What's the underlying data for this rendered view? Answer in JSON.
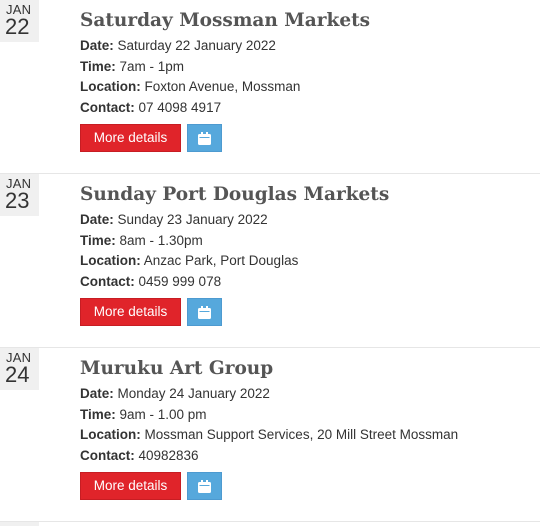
{
  "events": [
    {
      "month": "JAN",
      "day": "22",
      "title": "Saturday Mossman Markets",
      "date_label": "Date:",
      "date_value": " Saturday 22 January 2022",
      "time_label": "Time:",
      "time_value": " 7am - 1pm",
      "location_label": "Location:",
      "location_value": " Foxton Avenue, Mossman",
      "contact_label": "Contact:",
      "contact_value": " 07 4098 4917",
      "more_label": "More details",
      "calendar_icon": "calendar-icon"
    },
    {
      "month": "JAN",
      "day": "23",
      "title": "Sunday Port Douglas Markets",
      "date_label": "Date:",
      "date_value": " Sunday 23 January 2022",
      "time_label": "Time:",
      "time_value": " 8am - 1.30pm",
      "location_label": "Location:",
      "location_value": " Anzac Park, Port Douglas",
      "contact_label": "Contact:",
      "contact_value": " 0459 999 078",
      "more_label": "More details",
      "calendar_icon": "calendar-icon"
    },
    {
      "month": "JAN",
      "day": "24",
      "title": "Muruku Art Group",
      "date_label": "Date:",
      "date_value": " Monday 24 January 2022",
      "time_label": "Time:",
      "time_value": " 9am - 1.00 pm",
      "location_label": "Location:",
      "location_value": " Mossman Support Services, 20 Mill Street Mossman",
      "contact_label": "Contact:",
      "contact_value": " 40982836",
      "more_label": "More details",
      "calendar_icon": "calendar-icon"
    }
  ],
  "colors": {
    "more_button": "#e0242a",
    "calendar_button": "#56a8dc",
    "title_text": "#555555",
    "date_badge_bg": "#f0f0f0"
  }
}
